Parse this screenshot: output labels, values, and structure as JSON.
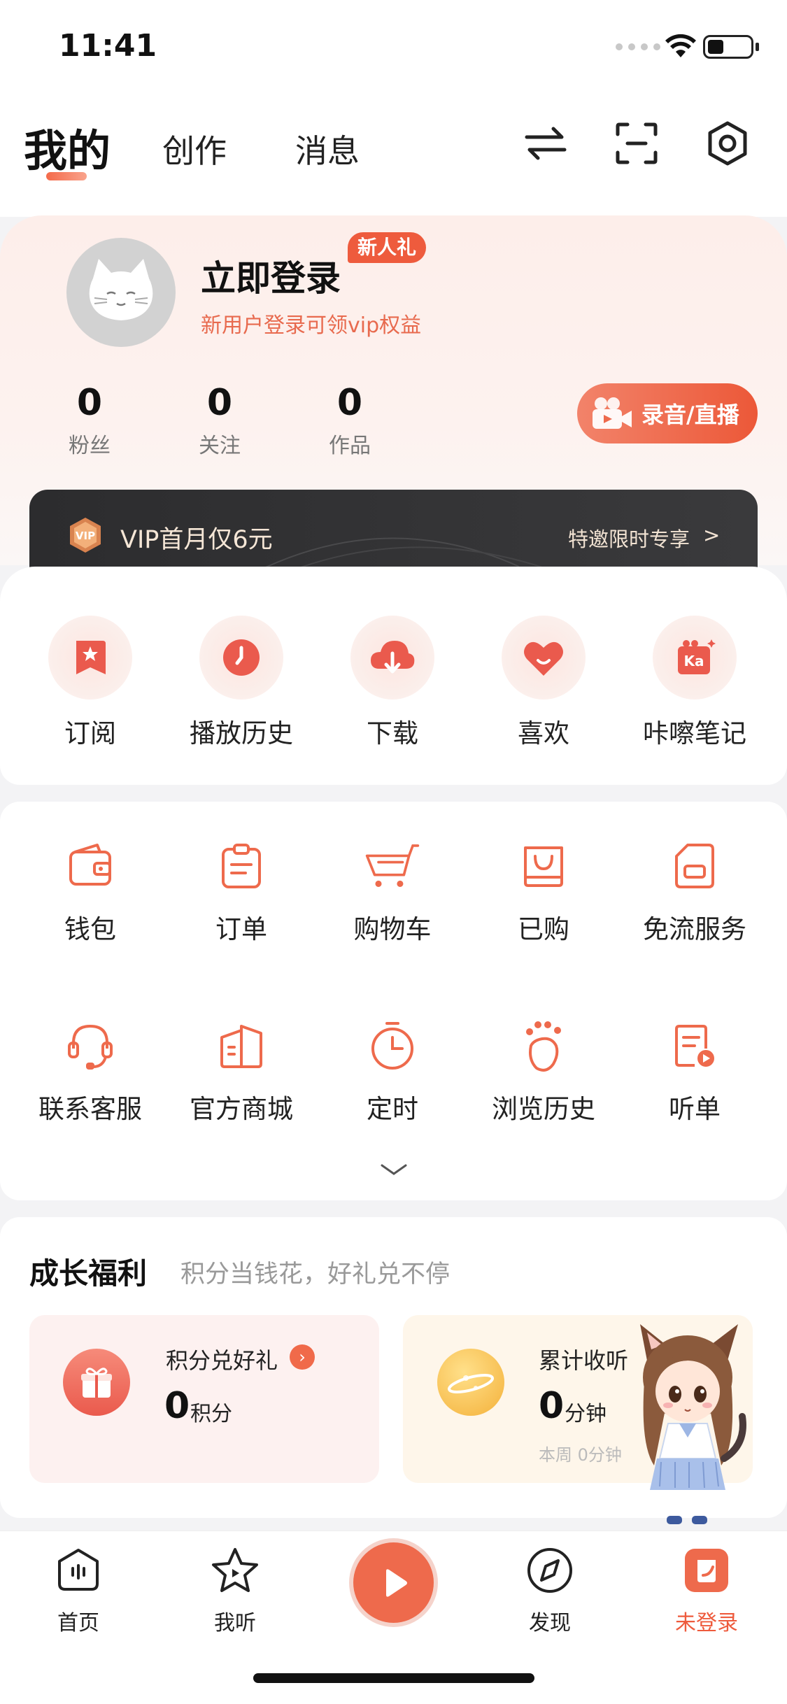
{
  "status": {
    "time": "11:41"
  },
  "tabs": [
    {
      "label": "我的"
    },
    {
      "label": "创作"
    },
    {
      "label": "消息"
    }
  ],
  "profile": {
    "login_title": "立即登录",
    "badge": "新人礼",
    "subtitle": "新用户登录可领vip权益",
    "stats": [
      {
        "value": "0",
        "label": "粉丝"
      },
      {
        "value": "0",
        "label": "关注"
      },
      {
        "value": "0",
        "label": "作品"
      }
    ],
    "record_button": "录音/直播"
  },
  "vip": {
    "text": "VIP首月仅6元",
    "right_text": "特邀限时专享",
    "arrow": ">"
  },
  "quick": [
    {
      "label": "订阅",
      "icon": "subscribe-icon"
    },
    {
      "label": "播放历史",
      "icon": "play-history-icon"
    },
    {
      "label": "下载",
      "icon": "download-icon"
    },
    {
      "label": "喜欢",
      "icon": "like-icon"
    },
    {
      "label": "咔嚓笔记",
      "icon": "note-icon"
    }
  ],
  "services": [
    {
      "label": "钱包",
      "icon": "wallet-icon"
    },
    {
      "label": "订单",
      "icon": "order-icon"
    },
    {
      "label": "购物车",
      "icon": "cart-icon"
    },
    {
      "label": "已购",
      "icon": "purchased-icon"
    },
    {
      "label": "免流服务",
      "icon": "free-data-icon"
    },
    {
      "label": "联系客服",
      "icon": "customer-service-icon"
    },
    {
      "label": "官方商城",
      "icon": "mall-icon"
    },
    {
      "label": "定时",
      "icon": "timer-icon"
    },
    {
      "label": "浏览历史",
      "icon": "browse-history-icon"
    },
    {
      "label": "听单",
      "icon": "playlist-icon"
    }
  ],
  "growth": {
    "title": "成长福利",
    "subtitle": "积分当钱花，好礼兑不停",
    "points": {
      "label": "积分兑好礼",
      "value": "0",
      "unit": "积分"
    },
    "listen": {
      "label": "累计收听",
      "value": "0",
      "unit": "分钟",
      "week": "本周 0分钟"
    }
  },
  "bottom_nav": [
    {
      "label": "首页",
      "icon": "home-icon"
    },
    {
      "label": "我听",
      "icon": "star-icon"
    },
    {
      "label": "发现",
      "icon": "discover-icon"
    },
    {
      "label": "未登录",
      "icon": "profile-icon"
    }
  ],
  "colors": {
    "accent": "#EE5B3D",
    "vip_bg": "#2C2C2E"
  }
}
